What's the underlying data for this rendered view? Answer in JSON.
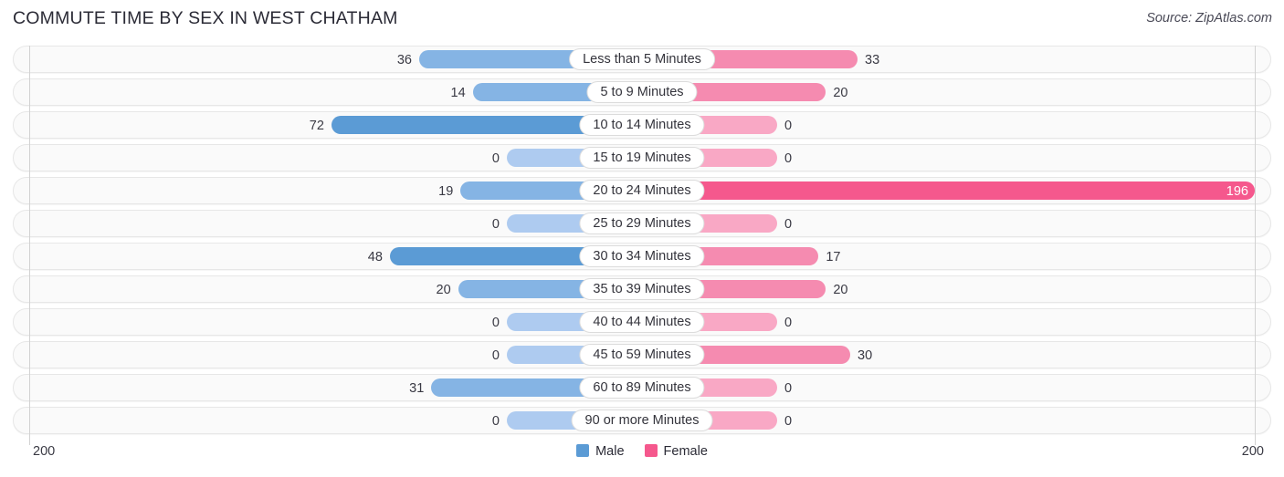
{
  "header": {
    "title": "COMMUTE TIME BY SEX IN WEST CHATHAM",
    "source": "Source: ZipAtlas.com"
  },
  "axis": {
    "left_label": "200",
    "right_label": "200"
  },
  "legend": {
    "items": [
      {
        "label": "Male",
        "color": "#5b9bd5"
      },
      {
        "label": "Female",
        "color": "#f5588d"
      }
    ]
  },
  "colors": {
    "male_light": "#aecbf0",
    "male_mid": "#85b4e4",
    "male_strong": "#5b9bd5",
    "female_light": "#f9a8c5",
    "female_mid": "#f58bb0",
    "female_strong": "#f5588d",
    "track": "#fafafa",
    "track_border": "#e7e7e7"
  },
  "chart_data": {
    "type": "bar",
    "title": "COMMUTE TIME BY SEX IN WEST CHATHAM",
    "subtitle": "Source: ZipAtlas.com",
    "orientation": "horizontal-diverging",
    "xlabel": "",
    "ylabel": "",
    "xlim": [
      200,
      200
    ],
    "axis_left_max": 200,
    "axis_right_max": 200,
    "grid": false,
    "legend_position": "bottom-center",
    "categories": [
      "Less than 5 Minutes",
      "5 to 9 Minutes",
      "10 to 14 Minutes",
      "15 to 19 Minutes",
      "20 to 24 Minutes",
      "25 to 29 Minutes",
      "30 to 34 Minutes",
      "35 to 39 Minutes",
      "40 to 44 Minutes",
      "45 to 59 Minutes",
      "60 to 89 Minutes",
      "90 or more Minutes"
    ],
    "series": [
      {
        "name": "Male",
        "color": "#5b9bd5",
        "side": "left",
        "values": [
          36,
          14,
          72,
          0,
          19,
          0,
          48,
          20,
          0,
          0,
          31,
          0
        ]
      },
      {
        "name": "Female",
        "color": "#f5588d",
        "side": "right",
        "values": [
          33,
          20,
          0,
          0,
          196,
          0,
          17,
          20,
          0,
          30,
          0,
          0
        ]
      }
    ]
  },
  "rows": [
    {
      "category": "Less than 5 Minutes",
      "male": "36",
      "female": "33",
      "male_value": 36,
      "female_value": 33,
      "male_shade": "mid",
      "female_shade": "mid",
      "female_inside": false
    },
    {
      "category": "5 to 9 Minutes",
      "male": "14",
      "female": "20",
      "male_value": 14,
      "female_value": 20,
      "male_shade": "mid",
      "female_shade": "mid",
      "female_inside": false
    },
    {
      "category": "10 to 14 Minutes",
      "male": "72",
      "female": "0",
      "male_value": 72,
      "female_value": 0,
      "male_shade": "strong",
      "female_shade": "light",
      "female_inside": false
    },
    {
      "category": "15 to 19 Minutes",
      "male": "0",
      "female": "0",
      "male_value": 0,
      "female_value": 0,
      "male_shade": "light",
      "female_shade": "light",
      "female_inside": false
    },
    {
      "category": "20 to 24 Minutes",
      "male": "19",
      "female": "196",
      "male_value": 19,
      "female_value": 196,
      "male_shade": "mid",
      "female_shade": "strong",
      "female_inside": true
    },
    {
      "category": "25 to 29 Minutes",
      "male": "0",
      "female": "0",
      "male_value": 0,
      "female_value": 0,
      "male_shade": "light",
      "female_shade": "light",
      "female_inside": false
    },
    {
      "category": "30 to 34 Minutes",
      "male": "48",
      "female": "17",
      "male_value": 48,
      "female_value": 17,
      "male_shade": "strong",
      "female_shade": "mid",
      "female_inside": false
    },
    {
      "category": "35 to 39 Minutes",
      "male": "20",
      "female": "20",
      "male_value": 20,
      "female_value": 20,
      "male_shade": "mid",
      "female_shade": "mid",
      "female_inside": false
    },
    {
      "category": "40 to 44 Minutes",
      "male": "0",
      "female": "0",
      "male_value": 0,
      "female_value": 0,
      "male_shade": "light",
      "female_shade": "light",
      "female_inside": false
    },
    {
      "category": "45 to 59 Minutes",
      "male": "0",
      "female": "30",
      "male_value": 0,
      "female_value": 30,
      "male_shade": "light",
      "female_shade": "mid",
      "female_inside": false
    },
    {
      "category": "60 to 89 Minutes",
      "male": "31",
      "female": "0",
      "male_value": 31,
      "female_value": 0,
      "male_shade": "mid",
      "female_shade": "light",
      "female_inside": false
    },
    {
      "category": "90 or more Minutes",
      "male": "0",
      "female": "0",
      "male_value": 0,
      "female_value": 0,
      "male_shade": "light",
      "female_shade": "light",
      "female_inside": false
    }
  ]
}
